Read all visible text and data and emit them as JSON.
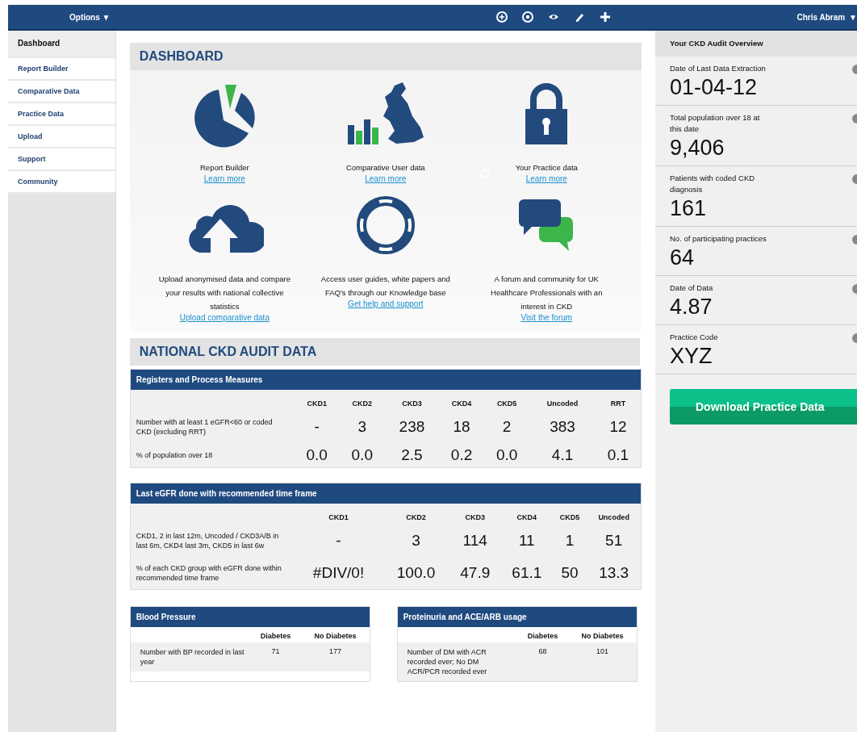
{
  "top_bar": {
    "options": "Options ▼",
    "user": "Chris Abram",
    "user_caret": "▼"
  },
  "sidebar": {
    "items": [
      {
        "label": "Dashboard",
        "selected": true
      },
      {
        "label": "Report Builder",
        "selected": false
      },
      {
        "label": "Comparative Data",
        "selected": false
      },
      {
        "label": "Practice Data",
        "selected": false
      },
      {
        "label": "Upload",
        "selected": false
      },
      {
        "label": "Support",
        "selected": false
      },
      {
        "label": "Community",
        "selected": false
      }
    ]
  },
  "dashboard": {
    "title": "DASHBOARD",
    "tiles": [
      {
        "text": "Report Builder",
        "link": "Learn more"
      },
      {
        "text": "Comparative User data",
        "link": "Learn more"
      },
      {
        "text": "Your Practice data",
        "link": "Learn more"
      },
      {
        "text": "Upload anonymised data and compare your results with national collective statistics",
        "link": "Upload comparative data"
      },
      {
        "text": "Access user guides, white papers and FAQ's through our Knowledge base",
        "link": "Get help and support"
      },
      {
        "text": "A forum and community for UK Healthcare Professionals with an interest in CKD",
        "link": "Visit the forum"
      }
    ]
  },
  "national": {
    "title": "NATIONAL CKD AUDIT DATA",
    "tables": [
      {
        "kind": "large",
        "title": "Registers and Process Measures",
        "columns": [
          "CKD1",
          "CKD2",
          "CKD3",
          "CKD4",
          "CKD5",
          "Uncoded",
          "RRT"
        ],
        "rows": [
          {
            "label": "Number with at least 1 eGFR<60 or coded CKD (excluding RRT)",
            "values": [
              "-",
              "3",
              "238",
              "18",
              "2",
              "383",
              "12"
            ]
          },
          {
            "label": "% of population over 18",
            "values": [
              "0.0",
              "0.0",
              "2.5",
              "0.2",
              "0.0",
              "4.1",
              "0.1"
            ]
          }
        ]
      },
      {
        "kind": "large",
        "title": "Last eGFR done with recommended time frame",
        "columns": [
          "CKD1",
          "CKD2",
          "CKD3",
          "CKD4",
          "CKD5",
          "Uncoded"
        ],
        "rows": [
          {
            "label": "CKD1, 2 in last 12m, Uncoded / CKD3A/B in last 6m, CKD4 last 3m, CKD5 in last 6w",
            "values": [
              "-",
              "3",
              "114",
              "11",
              "1",
              "51"
            ]
          },
          {
            "label": "% of each CKD group with eGFR done within recommended time frame",
            "values": [
              "#DIV/0!",
              "100.0",
              "47.9",
              "61.1",
              "50",
              "13.3"
            ]
          }
        ]
      },
      {
        "kind": "compact",
        "title": "Blood Pressure",
        "columns": [
          "Diabetes",
          "No Diabetes"
        ],
        "rows": [
          {
            "label": "Number with BP recorded in last year",
            "values": [
              "71",
              "177"
            ]
          }
        ]
      },
      {
        "kind": "compact",
        "title": "Proteinuria and ACE/ARB usage",
        "columns": [
          "Diabetes",
          "No Diabetes"
        ],
        "rows": [
          {
            "label": "Number of DM with ACR recorded ever; No DM ACR/PCR recorded ever",
            "values": [
              "68",
              "101"
            ]
          }
        ]
      }
    ]
  },
  "overview": {
    "title": "Your CKD Audit Overview",
    "items": [
      {
        "label": "Date of Last Data Extraction",
        "value": "01-04-12"
      },
      {
        "label": "Total population over 18 at this date",
        "value": "9,406"
      },
      {
        "label": "Patients with coded CKD diagnosis",
        "value": "161"
      },
      {
        "label": "No. of participating practices",
        "value": "64"
      },
      {
        "label": "Date of Data",
        "value": "4.87"
      },
      {
        "label": "Practice Code",
        "value": "XYZ"
      }
    ],
    "button": "Download Practice Data"
  }
}
